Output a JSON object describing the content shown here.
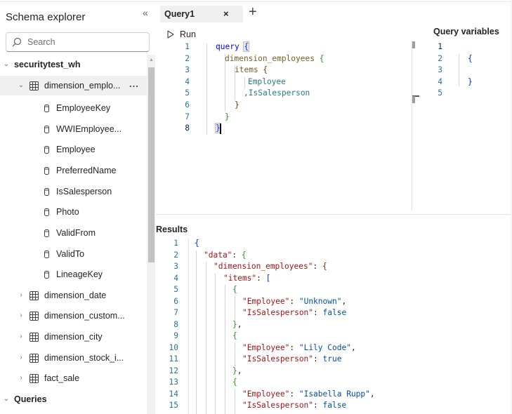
{
  "sidebar": {
    "title": "Schema explorer",
    "collapse_icon": "double-chevron-left-icon",
    "search": {
      "placeholder": "Search",
      "value": ""
    },
    "tree": {
      "warehouse": "securitytest_wh",
      "tables": [
        {
          "name": "dimension_emplo...",
          "expanded": true,
          "columns": [
            "EmployeeKey",
            "WWIEmployee...",
            "Employee",
            "PreferredName",
            "IsSalesperson",
            "Photo",
            "ValidFrom",
            "ValidTo",
            "LineageKey"
          ]
        },
        {
          "name": "dimension_date",
          "expanded": false
        },
        {
          "name": "dimension_custom...",
          "expanded": false
        },
        {
          "name": "dimension_city",
          "expanded": false
        },
        {
          "name": "dimension_stock_i...",
          "expanded": false
        },
        {
          "name": "fact_sale",
          "expanded": false
        }
      ],
      "queries_label": "Queries"
    },
    "more_label": "..."
  },
  "tabs": [
    {
      "label": "Query1",
      "close": "×"
    }
  ],
  "add_tab_label": "+",
  "toolbar": {
    "run_label": "Run"
  },
  "query_editor": {
    "line_numbers": [
      "1",
      "2",
      "3",
      "4",
      "5",
      "6",
      "7",
      "8"
    ],
    "lines": [
      [
        "query ",
        "{"
      ],
      [
        "dimension_employees ",
        "{"
      ],
      [
        "items ",
        "{"
      ],
      [
        "Employee"
      ],
      [
        ",IsSalesperson"
      ],
      [
        "}"
      ],
      [
        "}"
      ],
      [
        "}"
      ]
    ]
  },
  "query_variables": {
    "title": "Query variables",
    "line_numbers": [
      "1",
      "2",
      "3",
      "4",
      "5"
    ],
    "lines": [
      "",
      "{",
      "",
      "}",
      ""
    ]
  },
  "results": {
    "title": "Results",
    "line_numbers": [
      "1",
      "2",
      "3",
      "4",
      "5",
      "6",
      "7",
      "8",
      "9",
      "10",
      "11",
      "12",
      "13",
      "14",
      "15"
    ],
    "data": {
      "root_open": "{",
      "data_key": "\"data\"",
      "table_key": "\"dimension_employees\"",
      "items_key": "\"items\"",
      "items": [
        {
          "Employee": "\"Unknown\"",
          "IsSalesperson": "false"
        },
        {
          "Employee": "\"Lily Code\"",
          "IsSalesperson": "true"
        },
        {
          "Employee": "\"Isabella Rupp\"",
          "IsSalesperson": "false"
        }
      ],
      "employee_key": "\"Employee\"",
      "salesperson_key": "\"IsSalesperson\""
    }
  }
}
